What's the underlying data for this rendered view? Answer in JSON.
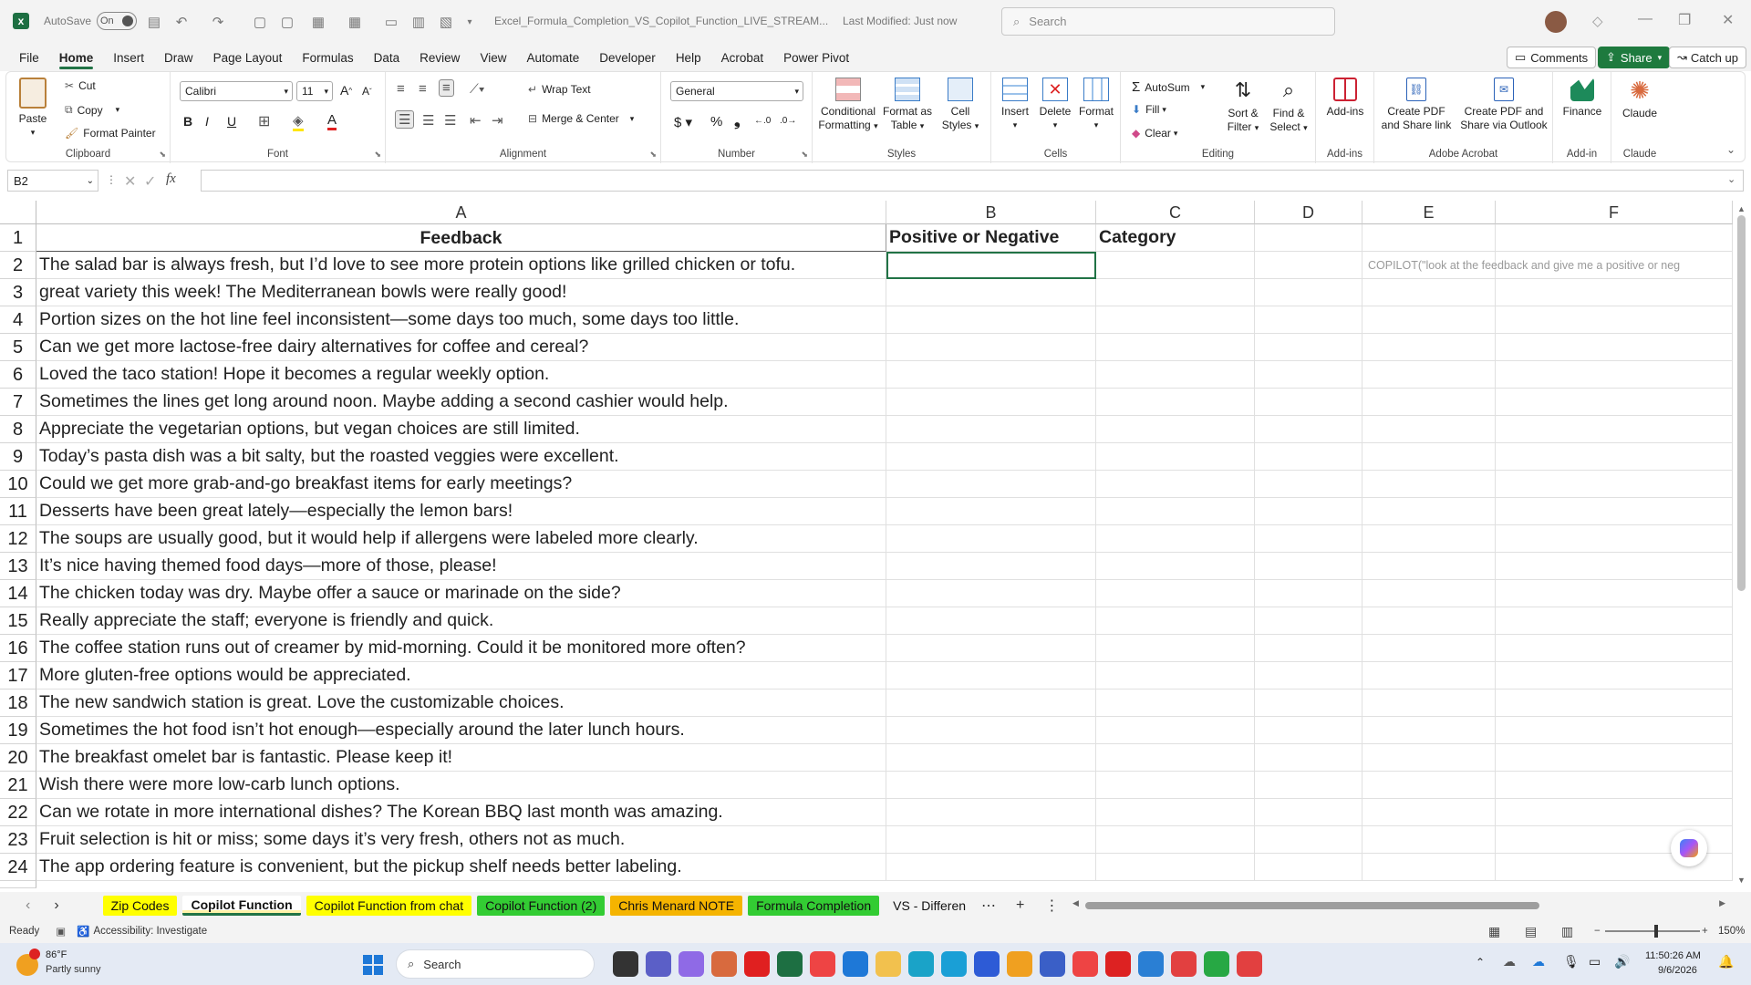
{
  "titlebar": {
    "autosave_label": "AutoSave",
    "autosave_state": "On",
    "filename": "Excel_Formula_Completion_VS_Copilot_Function_LIVE_STREAM...",
    "last_modified": "Last Modified: Just now",
    "search_placeholder": "Search"
  },
  "menu": {
    "items": [
      "File",
      "Home",
      "Insert",
      "Draw",
      "Page Layout",
      "Formulas",
      "Data",
      "Review",
      "View",
      "Automate",
      "Developer",
      "Help",
      "Acrobat",
      "Power Pivot"
    ],
    "active": "Home",
    "comments": "Comments",
    "share": "Share",
    "catchup": "Catch up"
  },
  "ribbon": {
    "clipboard": {
      "paste": "Paste",
      "cut": "Cut",
      "copy": "Copy",
      "format_painter": "Format Painter",
      "label": "Clipboard"
    },
    "font": {
      "name": "Calibri",
      "size": "11",
      "label": "Font",
      "bold": "B",
      "italic": "I",
      "underline": "U"
    },
    "alignment": {
      "wrap": "Wrap Text",
      "merge": "Merge & Center",
      "label": "Alignment"
    },
    "number": {
      "format": "General",
      "label": "Number"
    },
    "styles": {
      "conditional_1": "Conditional",
      "conditional_2": "Formatting",
      "format_table_1": "Format as",
      "format_table_2": "Table",
      "cell_styles_1": "Cell",
      "cell_styles_2": "Styles",
      "label": "Styles"
    },
    "cells": {
      "insert": "Insert",
      "delete": "Delete",
      "format": "Format",
      "label": "Cells"
    },
    "editing": {
      "autosum": "AutoSum",
      "fill": "Fill",
      "clear": "Clear",
      "sort_1": "Sort &",
      "sort_2": "Filter",
      "find_1": "Find &",
      "find_2": "Select",
      "label": "Editing"
    },
    "addins": {
      "addins": "Add-ins",
      "label": "Add-ins"
    },
    "acrobat": {
      "create_pdf_1": "Create PDF",
      "create_pdf_2": "and Share link",
      "create_outlook_1": "Create PDF and",
      "create_outlook_2": "Share via Outlook",
      "label": "Adobe Acrobat"
    },
    "finance": {
      "finance": "Finance",
      "label": "Add-in"
    },
    "claude": {
      "claude": "Claude",
      "label": "Claude"
    }
  },
  "formula_bar": {
    "name_box": "B2",
    "fx": "fx",
    "formula": ""
  },
  "grid": {
    "columns": [
      "A",
      "B",
      "C",
      "D",
      "E",
      "F"
    ],
    "header_row": {
      "A": "Feedback",
      "B": "Positive or Negative",
      "C": "Category"
    },
    "copilot_hint": "COPILOT(\"look at the feedback and give me a positive or neg",
    "rows": [
      {
        "n": "2",
        "a": "The salad bar is always fresh, but I’d love to see more protein options like grilled chicken or tofu."
      },
      {
        "n": "3",
        "a": "great  variety this week! The Mediterranean bowls were really good!"
      },
      {
        "n": "4",
        "a": "Portion sizes on the hot line feel inconsistent—some days too much, some days too little."
      },
      {
        "n": "5",
        "a": "Can we get more lactose-free dairy alternatives for coffee and cereal?"
      },
      {
        "n": "6",
        "a": "Loved the taco station! Hope it becomes a regular weekly option."
      },
      {
        "n": "7",
        "a": "Sometimes the lines get long around noon. Maybe adding a second cashier would help."
      },
      {
        "n": "8",
        "a": "Appreciate the vegetarian options, but vegan choices are still limited."
      },
      {
        "n": "9",
        "a": "Today’s pasta dish was a bit salty, but the roasted veggies were excellent."
      },
      {
        "n": "10",
        "a": "Could we get more grab-and-go breakfast items for early meetings?"
      },
      {
        "n": "11",
        "a": "Desserts have been great lately—especially the lemon bars!"
      },
      {
        "n": "12",
        "a": "The soups are usually good, but it would help if allergens were labeled more clearly."
      },
      {
        "n": "13",
        "a": "It’s nice having themed food days—more of those, please!"
      },
      {
        "n": "14",
        "a": "The chicken today was dry. Maybe offer a sauce or marinade on the side?"
      },
      {
        "n": "15",
        "a": "Really appreciate the staff; everyone is friendly and quick."
      },
      {
        "n": "16",
        "a": "The coffee station runs out of creamer by mid-morning. Could it be monitored more often?"
      },
      {
        "n": "17",
        "a": "More gluten-free options would be appreciated."
      },
      {
        "n": "18",
        "a": "The new sandwich station is great. Love the customizable choices."
      },
      {
        "n": "19",
        "a": "Sometimes the hot food isn’t hot enough—especially around the later lunch hours."
      },
      {
        "n": "20",
        "a": "The breakfast omelet bar is fantastic. Please keep it!"
      },
      {
        "n": "21",
        "a": "Wish there were more low-carb lunch options."
      },
      {
        "n": "22",
        "a": "Can we rotate in more international dishes? The Korean BBQ last month was amazing."
      },
      {
        "n": "23",
        "a": "Fruit selection is hit or miss; some days it’s very fresh, others not as much."
      },
      {
        "n": "24",
        "a": "The app ordering feature is convenient, but the pickup shelf needs better labeling."
      }
    ]
  },
  "sheets": [
    {
      "name": "Zip Codes",
      "color": "#ffff00"
    },
    {
      "name": "Copilot Function",
      "color": "#fff2a8",
      "active": true
    },
    {
      "name": "Copilot Function from chat",
      "color": "#ffff00"
    },
    {
      "name": "Copilot Function (2)",
      "color": "#33cc33"
    },
    {
      "name": "Chris Menard NOTE",
      "color": "#f5b400"
    },
    {
      "name": "Formula Completion",
      "color": "#33cc33"
    },
    {
      "name": "VS - Differen",
      "color": ""
    }
  ],
  "status": {
    "ready": "Ready",
    "accessibility": "Accessibility: Investigate",
    "zoom": "150%"
  },
  "taskbar": {
    "temp": "86°F",
    "weather": "Partly sunny",
    "search": "Search",
    "time": "11:50:26 AM",
    "date": "9/6/2026"
  },
  "colors": {
    "excel_green": "#217346",
    "share_green": "#1e7a3e"
  }
}
